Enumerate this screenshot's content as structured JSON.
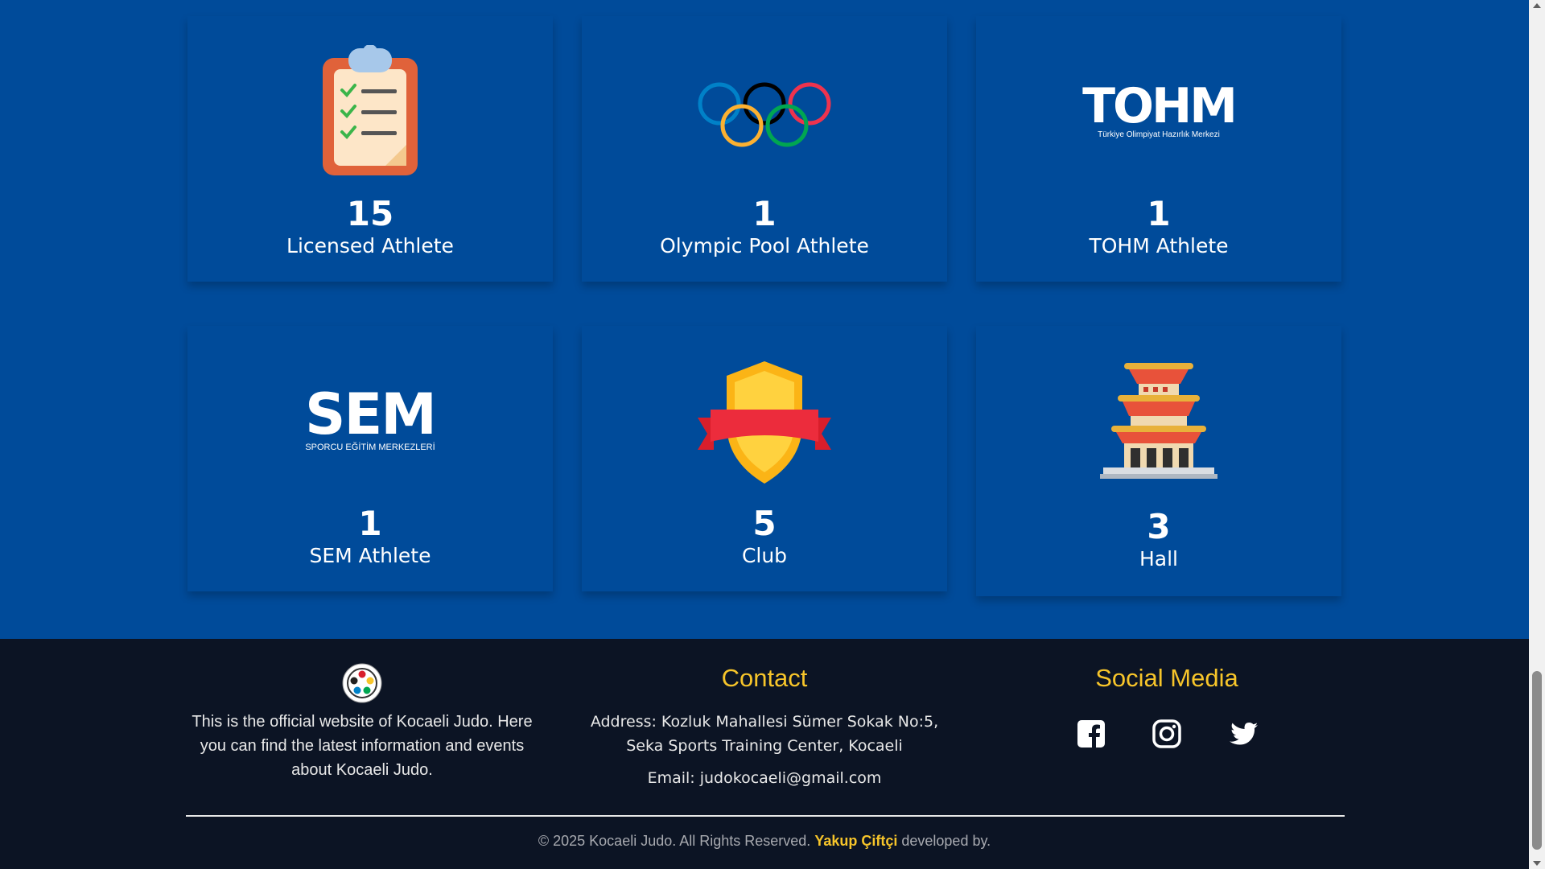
{
  "stats": [
    {
      "id": "licensed",
      "icon": "clipboard-checklist-icon",
      "value": "15",
      "label": "Licensed Athlete"
    },
    {
      "id": "olympic",
      "icon": "olympic-rings-icon",
      "value": "1",
      "label": "Olympic Pool Athlete"
    },
    {
      "id": "tohm",
      "icon": "tohm-logo-icon",
      "value": "1",
      "label": "TOHM Athlete",
      "logo_text": "TOHM",
      "logo_subtext": "Türkiye Olimpiyat Hazırlık Merkezi"
    },
    {
      "id": "sem",
      "icon": "sem-logo-icon",
      "value": "1",
      "label": "SEM Athlete",
      "logo_text": "SEM",
      "logo_subtext": "SPORCU EĞİTİM MERKEZLERİ"
    },
    {
      "id": "club",
      "icon": "shield-badge-icon",
      "value": "5",
      "label": "Club"
    },
    {
      "id": "hall",
      "icon": "pagoda-hall-icon",
      "value": "3",
      "label": "Hall"
    }
  ],
  "footer": {
    "about": {
      "logo_icon": "judo-federation-emblem-icon",
      "text": "This is the official website of Kocaeli Judo. Here you can find the latest information and events about Kocaeli Judo."
    },
    "contact": {
      "title": "Contact",
      "address_line1": "Address: Kozluk Mahallesi Sümer Sokak No:5,",
      "address_line2": "Seka Sports Training Center, Kocaeli",
      "email": "Email: judokocaeli@gmail.com"
    },
    "social": {
      "title": "Social Media",
      "icons": [
        "facebook-icon",
        "instagram-icon",
        "twitter-icon"
      ]
    },
    "copyright": {
      "prefix": "© 2025 Kocaeli Judo. All Rights Reserved.",
      "developer": "Yakup Çiftçi",
      "suffix": "developed by."
    }
  },
  "colors": {
    "section_bg": "#004b9a",
    "footer_bg": "#0c1424",
    "accent": "#f7c52a"
  }
}
